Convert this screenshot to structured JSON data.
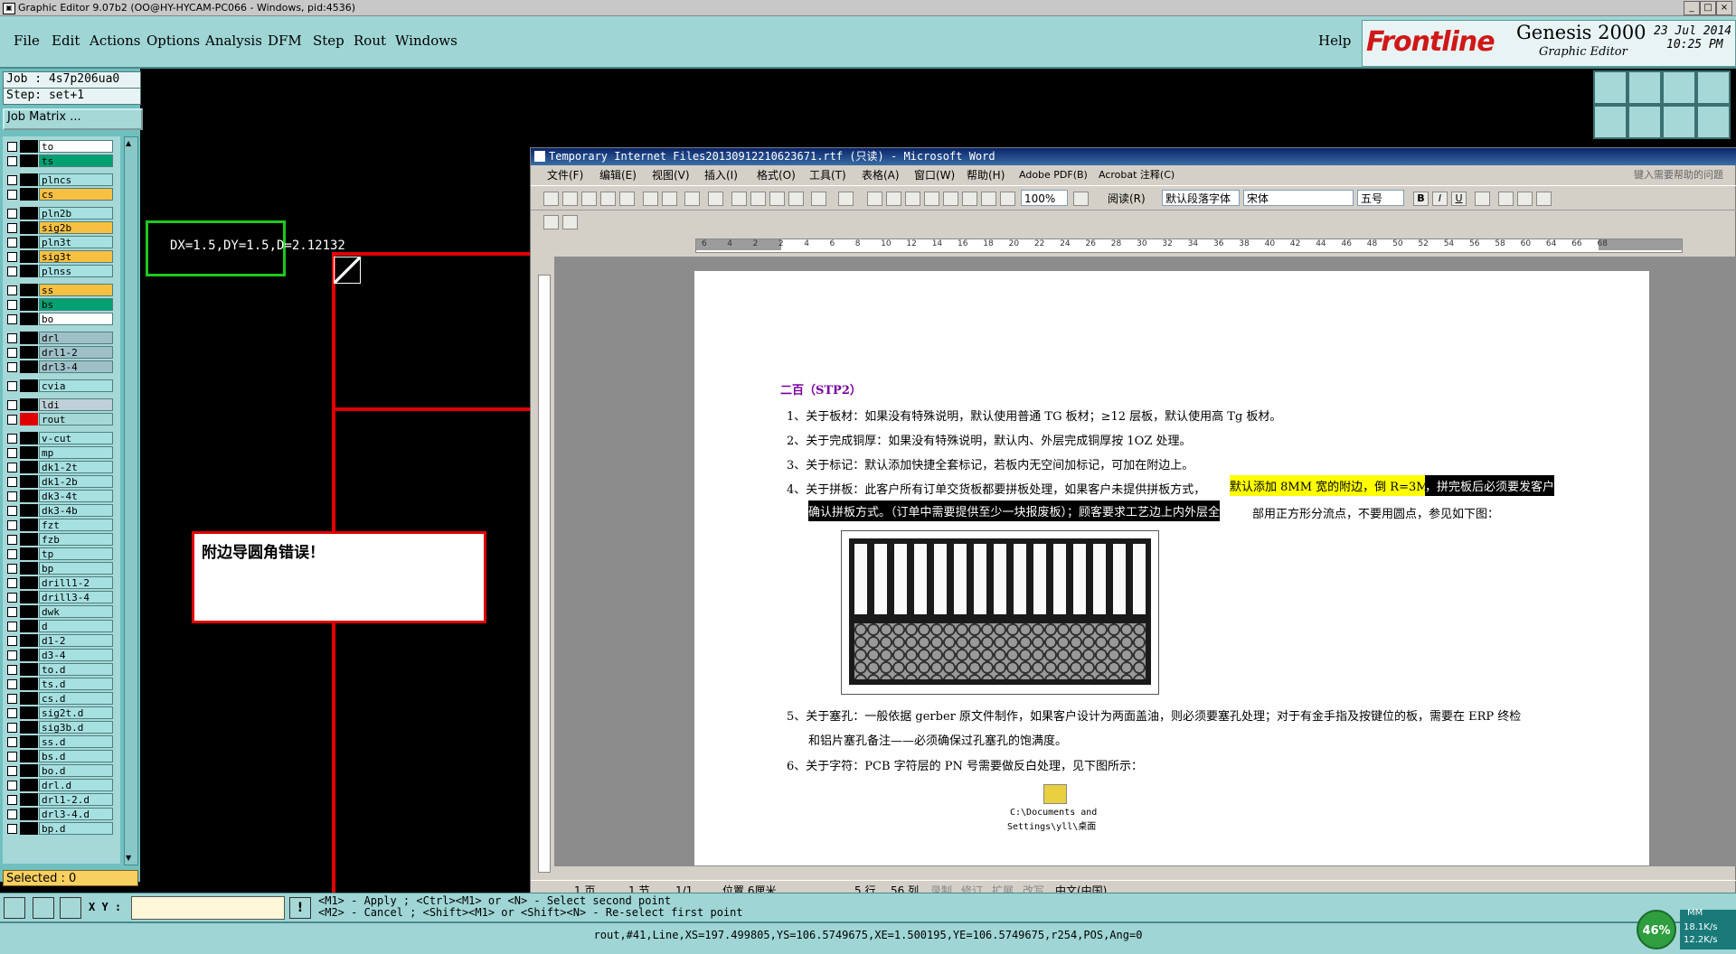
{
  "window": {
    "title": "Graphic Editor 9.07b2 (OO@HY-HYCAM-PC066 - Windows, pid:4536)"
  },
  "menu": [
    "File",
    "Edit",
    "Actions",
    "Options",
    "Analysis",
    "DFM",
    "Step",
    "Rout",
    "Windows"
  ],
  "help": "Help",
  "brand": {
    "logo": "Frontline",
    "product": "Genesis 2000",
    "sub": "Graphic Editor",
    "date": "23 Jul 2014",
    "time": "10:25 PM"
  },
  "job": {
    "job": "Job : 4s7p206ua0",
    "step": "Step: set+1",
    "matrix": "Job Matrix ..."
  },
  "layers": [
    {
      "name": "to",
      "color": "#ffffff"
    },
    {
      "name": "ts",
      "color": "#00a070"
    },
    {
      "name": "plncs",
      "color": "#a6e0e0"
    },
    {
      "name": "cs",
      "color": "#f8c040"
    },
    {
      "name": "pln2b",
      "color": "#a6e0e0"
    },
    {
      "name": "sig2b",
      "color": "#f8c040"
    },
    {
      "name": "pln3t",
      "color": "#a6e0e0"
    },
    {
      "name": "sig3t",
      "color": "#f8c040"
    },
    {
      "name": "plnss",
      "color": "#a6e0e0"
    },
    {
      "name": "ss",
      "color": "#f8c040"
    },
    {
      "name": "bs",
      "color": "#00a070"
    },
    {
      "name": "bo",
      "color": "#ffffff"
    },
    {
      "name": "drl",
      "color": "#a0c0c8"
    },
    {
      "name": "drl1-2",
      "color": "#a0c0c8"
    },
    {
      "name": "drl3-4",
      "color": "#a0c0c8"
    },
    {
      "name": "cvia",
      "color": "#a6e0e0"
    },
    {
      "name": "ldi",
      "color": "#c0d0d8"
    },
    {
      "name": "rout",
      "color": "#a6d8d8"
    },
    {
      "name": "v-cut",
      "color": "#a6e0e0"
    },
    {
      "name": "mp",
      "color": "#a6e0e0"
    },
    {
      "name": "dk1-2t",
      "color": "#a6e0e0"
    },
    {
      "name": "dk1-2b",
      "color": "#a6e0e0"
    },
    {
      "name": "dk3-4t",
      "color": "#a6e0e0"
    },
    {
      "name": "dk3-4b",
      "color": "#a6e0e0"
    },
    {
      "name": "fzt",
      "color": "#a6e0e0"
    },
    {
      "name": "fzb",
      "color": "#a6e0e0"
    },
    {
      "name": "tp",
      "color": "#a6e0e0"
    },
    {
      "name": "bp",
      "color": "#a6e0e0"
    },
    {
      "name": "drill1-2",
      "color": "#a6e0e0"
    },
    {
      "name": "drill3-4",
      "color": "#a6e0e0"
    },
    {
      "name": "dwk",
      "color": "#a6e0e0"
    },
    {
      "name": "d",
      "color": "#a6e0e0"
    },
    {
      "name": "d1-2",
      "color": "#a6e0e0"
    },
    {
      "name": "d3-4",
      "color": "#a6e0e0"
    },
    {
      "name": "to.d",
      "color": "#a6e0e0"
    },
    {
      "name": "ts.d",
      "color": "#a6e0e0"
    },
    {
      "name": "cs.d",
      "color": "#a6e0e0"
    },
    {
      "name": "sig2t.d",
      "color": "#a6e0e0"
    },
    {
      "name": "sig3b.d",
      "color": "#a6e0e0"
    },
    {
      "name": "ss.d",
      "color": "#a6e0e0"
    },
    {
      "name": "bs.d",
      "color": "#a6e0e0"
    },
    {
      "name": "bo.d",
      "color": "#a6e0e0"
    },
    {
      "name": "drl.d",
      "color": "#a6e0e0"
    },
    {
      "name": "drl1-2.d",
      "color": "#a6e0e0"
    },
    {
      "name": "drl3-4.d",
      "color": "#a6e0e0"
    },
    {
      "name": "bp.d",
      "color": "#a6e0e0"
    }
  ],
  "selected": "Selected : 0",
  "canvas": {
    "measure": "DX=1.5,DY=1.5,D=2.12132",
    "error": "附边导圆角错误！"
  },
  "bottom": {
    "xy_label": "X Y :",
    "hint1": "<M1> - Apply  ; <Ctrl><M1> or <N> - Select second point",
    "hint2": "<M2> - Cancel ; <Shift><M1> or <Shift><N> - Re-select first point",
    "status": "rout,#41,Line,XS=197.499805,YS=106.5749675,XE=1.500195,YE=106.5749675,r254,POS,Ang=0"
  },
  "net": {
    "percent": "46%",
    "up": "18.1K/s",
    "down": "12.2K/s",
    "unit": "MM"
  },
  "word": {
    "title": "Temporary Internet Files20130912210623671.rtf (只读) - Microsoft Word",
    "menu": [
      "文件(F)",
      "编辑(E)",
      "视图(V)",
      "插入(I)",
      "格式(O)",
      "工具(T)",
      "表格(A)",
      "窗口(W)",
      "帮助(H)",
      "Adobe PDF(B)",
      "Acrobat 注释(C)"
    ],
    "help_box": "键入需要帮助的问题",
    "zoom": "100%",
    "read": "阅读(R)",
    "style": "默认段落字体",
    "font": "宋体",
    "size": "五号",
    "ruler_ticks": [
      "6",
      "4",
      "2",
      "2",
      "4",
      "6",
      "8",
      "10",
      "12",
      "14",
      "16",
      "18",
      "20",
      "22",
      "24",
      "26",
      "28",
      "30",
      "32",
      "34",
      "36",
      "38",
      "40",
      "42",
      "44",
      "46",
      "48",
      "50",
      "52",
      "54",
      "56",
      "58",
      "60",
      "64",
      "66",
      "68"
    ],
    "doc": {
      "heading": "二百（STP2）",
      "p1": "1、关于板材：如果没有特殊说明，默认使用普通 TG 板材；≥12 层板，默认使用高 Tg 板材。",
      "p2": "2、关于完成铜厚：如果没有特殊说明，默认内、外层完成铜厚按 1OZ 处理。",
      "p3": "3、关于标记：默认添加快捷全套标记，若板内无空间加标记，可加在附边上。",
      "p4a": "4、关于拼板：此客户所有订单交货板都要拼板处理，如果客户未提供拼板方式，",
      "p4hl": "默认添加 8MM 宽的附边，倒 R=3MM",
      "p4b": "，拼完板后必须要发客户",
      "p4c": "确认拼板方式。（订单中需要提供至少一块报废板）；顾客要求工艺边上内外层全",
      "p4d": "部用正方形分流点，不要用圆点，参见如下图：",
      "p5a": "5、关于塞孔：一般依据 gerber 原文件制作，如果客户设计为两面盖油，则必须要塞孔处理；对于有金手指及按键位的板，需要在 ERP 终检",
      "p5b": "和铝片塞孔备注——必须确保过孔塞孔的饱满度。",
      "p6": "6、关于字符：PCB 字符层的 PN 号需要做反白处理，见下图所示：",
      "objlabel1": "C:\\Documents and",
      "objlabel2": "Settings\\yll\\桌面"
    },
    "status": [
      "1 页",
      "1 节",
      "1/1",
      "位置 6厘米",
      "5 行",
      "56 列",
      "录制",
      "修订",
      "扩展",
      "改写",
      "中文(中国)"
    ]
  }
}
